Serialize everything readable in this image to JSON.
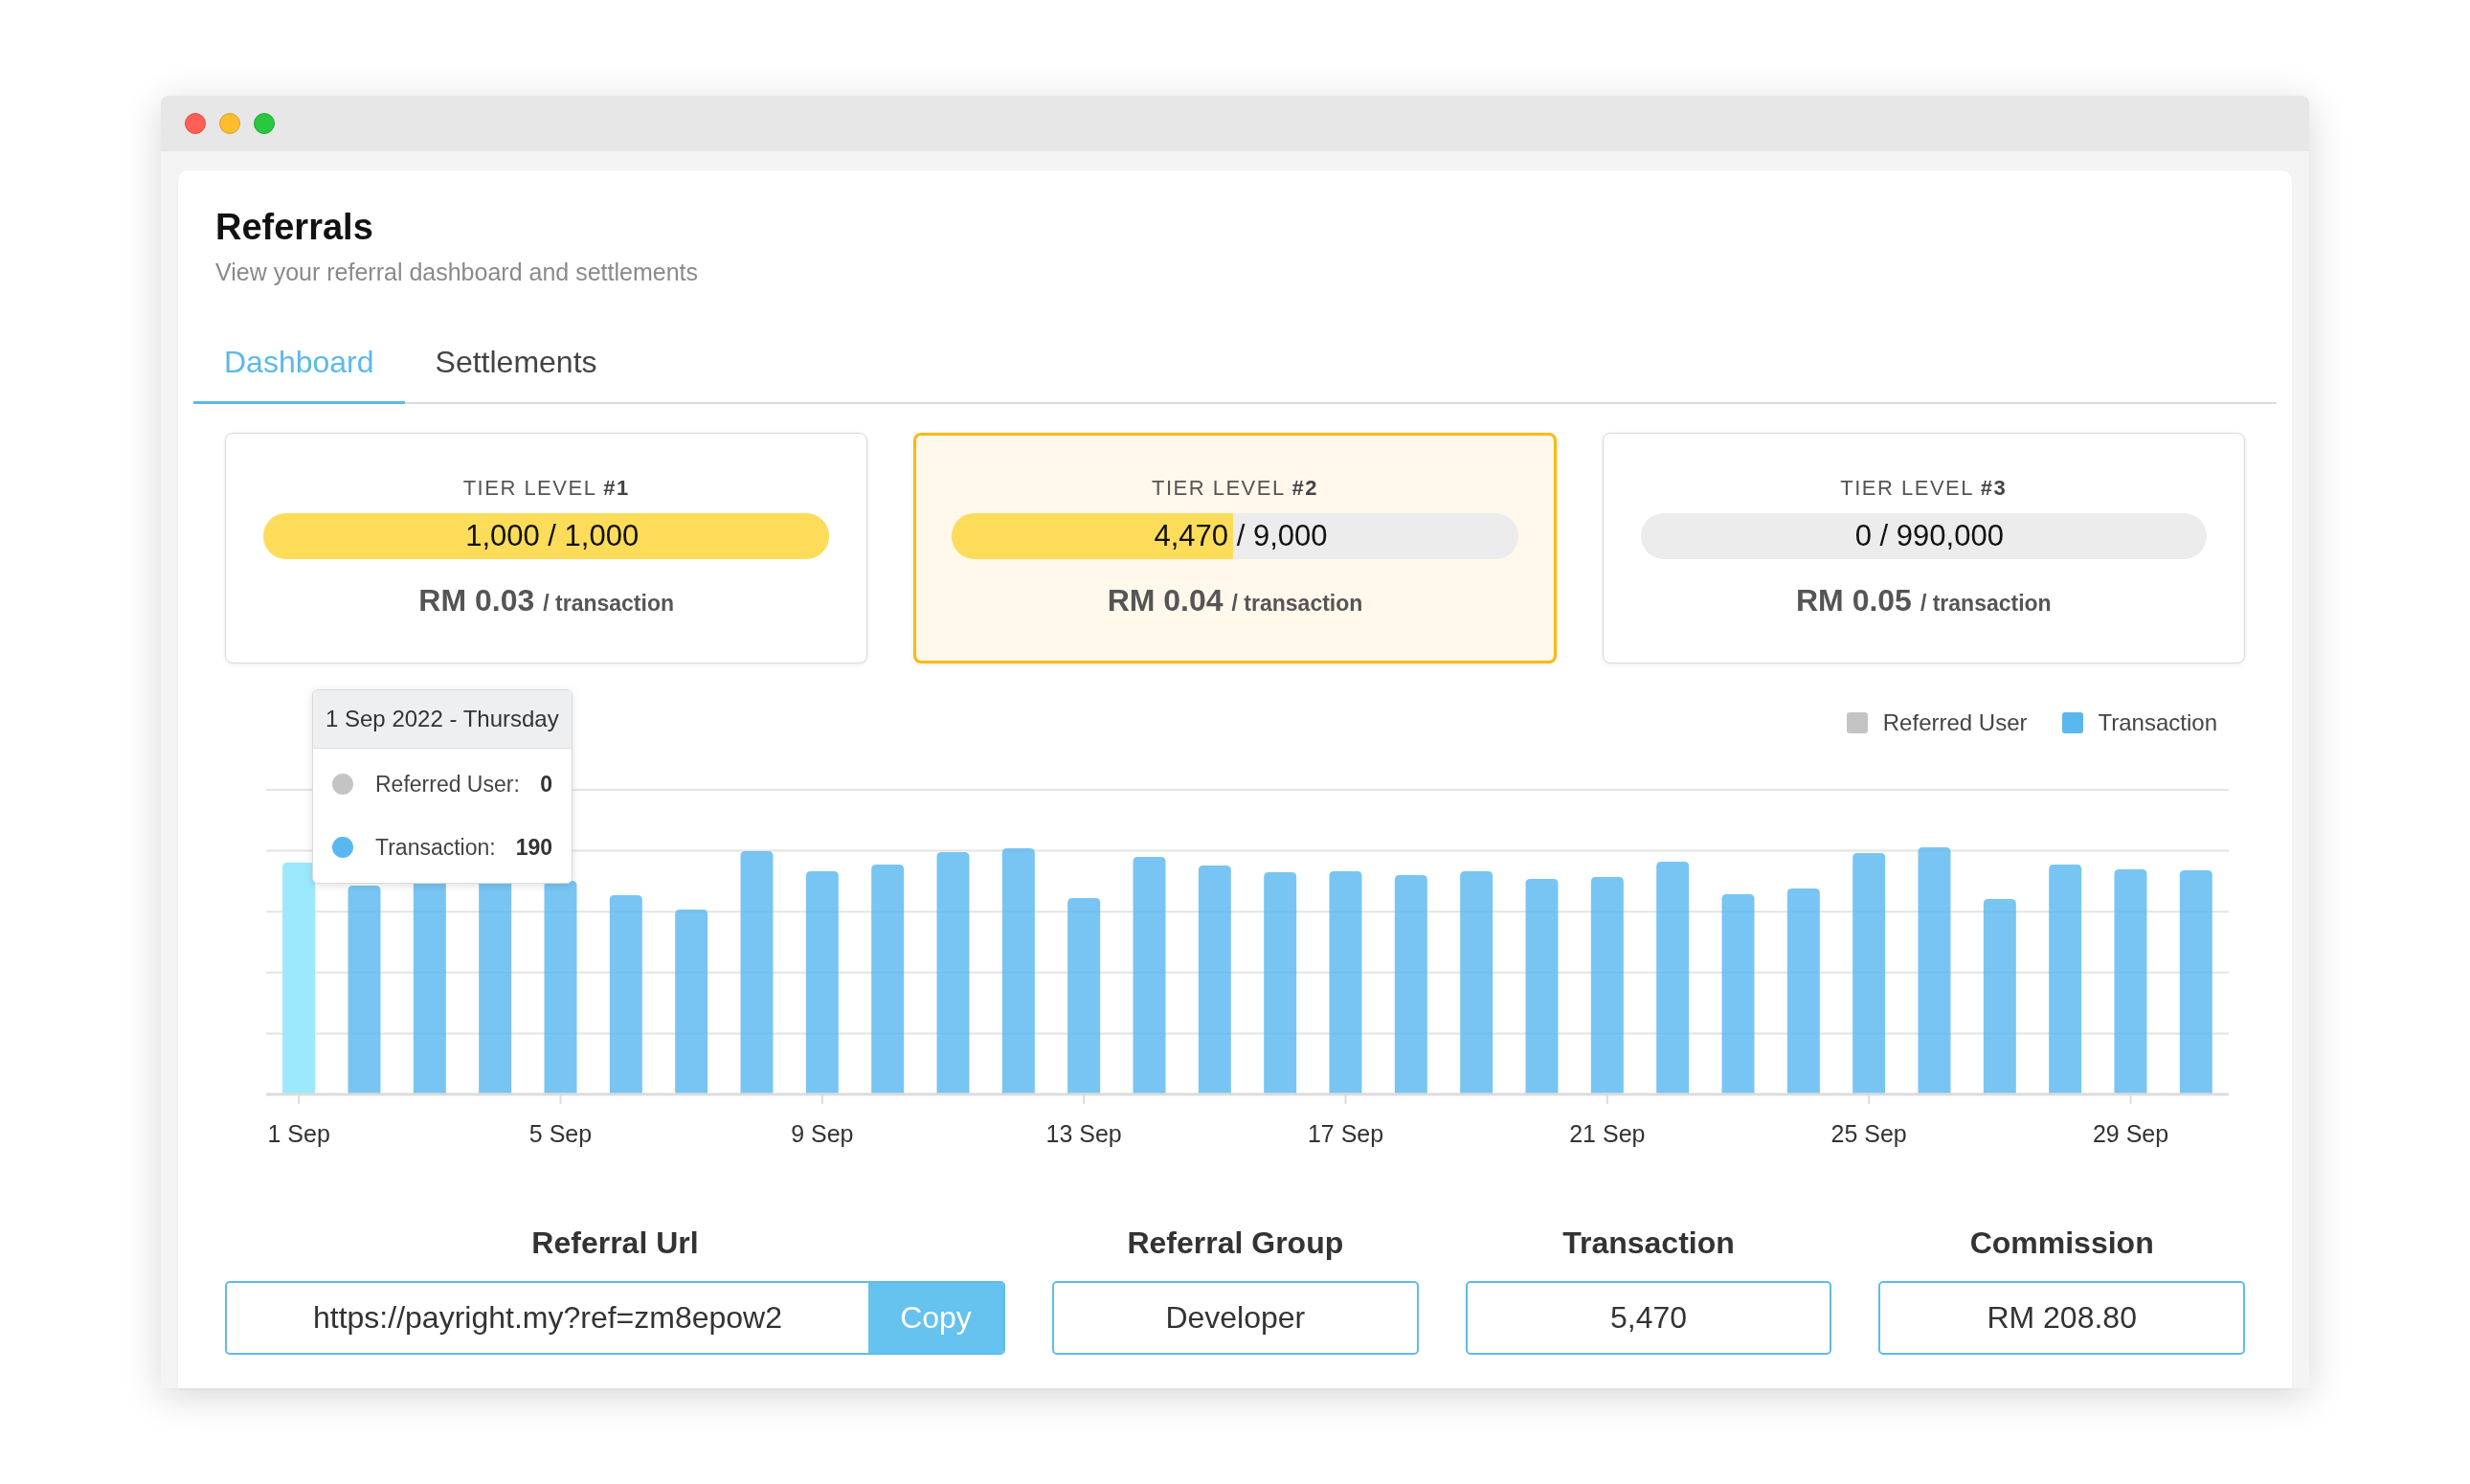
{
  "header": {
    "title": "Referrals",
    "subtitle": "View your referral dashboard and settlements"
  },
  "tabs": [
    {
      "label": "Dashboard",
      "selected": true
    },
    {
      "label": "Settlements",
      "selected": false
    }
  ],
  "tiers": [
    {
      "title": "TIER LEVEL **#1**",
      "level": 1,
      "progress": "1,000 / 1,000",
      "rate": "RM 0.03",
      "unit": "/ transaction",
      "current": false
    },
    {
      "title": "TIER LEVEL **#2**",
      "level": 0.497,
      "progress": "4,470 / 9,000",
      "rate": "RM 0.04",
      "unit": "/ transaction",
      "current": true
    },
    {
      "title": "TIER LEVEL **#3**",
      "progress": "0 / 990,000",
      "rate": "RM 0.05",
      "unit": "/ transaction",
      "current": false
    }
  ],
  "chart": {
    "legend": [
      {
        "label": "Referred User",
        "color": "#c4c4c4"
      },
      {
        "label": "Transaction",
        "color": "#5ab8f0"
      }
    ],
    "x_labels": [
      "1 Sep",
      "5 Sep",
      "9 Sep",
      "13 Sep",
      "17 Sep",
      "21 Sep",
      "25 Sep",
      "29 Sep"
    ],
    "tooltip": {
      "title": "1 Sep 2022 - Thursday",
      "rows": [
        {
          "label": "Referred User:",
          "value": "0",
          "color": "#c4c4c4"
        },
        {
          "label": "Transaction:",
          "value": "190",
          "color": "#5ab8f0"
        }
      ]
    }
  },
  "fields": [
    {
      "label": "Referral Url",
      "value": "https://payright.my?ref=zm8epow2",
      "button": "Copy"
    },
    {
      "label": "Referral Group",
      "value": "Developer"
    },
    {
      "label": "Transaction",
      "value": "5,470"
    },
    {
      "label": "Commission",
      "value": "RM 208.80"
    }
  ]
}
